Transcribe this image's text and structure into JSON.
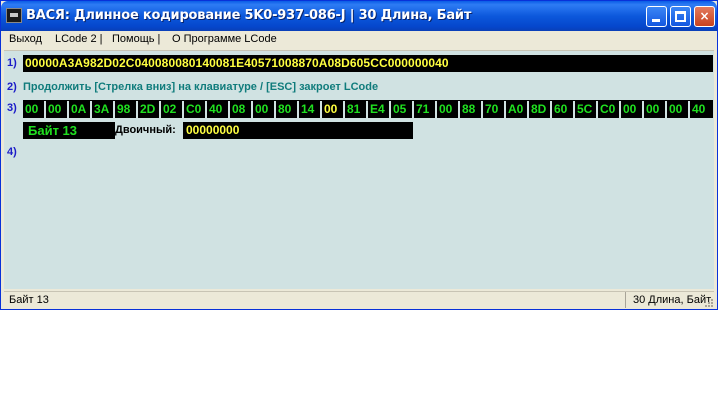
{
  "window": {
    "title": "ВАСЯ: Длинное кодирование  5K0-937-086-J |  30 Длина, Байт",
    "icon": "app-icon",
    "controls": {
      "minimize_icon": "minimize-icon",
      "maximize_icon": "maximize-icon",
      "close_label": "×"
    }
  },
  "menu": [
    {
      "label": "Выход"
    },
    {
      "label": "LCode 2 |"
    },
    {
      "label": "Помощь |"
    },
    {
      "label": "О Программе LCode"
    }
  ],
  "rows": {
    "r1": "1)",
    "r2": "2)",
    "r3": "3)",
    "r4": "4)"
  },
  "hex_string": "00000A3A982D02C040080080140081E40571008870A08D605CC000000040",
  "hint": "Продолжить [Стрелка вниз] на клавиатуре / [ESC] закроет LCode",
  "bytes": [
    "00",
    "00",
    "0A",
    "3A",
    "98",
    "2D",
    "02",
    "C0",
    "40",
    "08",
    "00",
    "80",
    "14",
    "00",
    "81",
    "E4",
    "05",
    "71",
    "00",
    "88",
    "70",
    "A0",
    "8D",
    "60",
    "5C",
    "C0",
    "00",
    "00",
    "00",
    "40"
  ],
  "selected_byte_index": 13,
  "byte_label": "Байт 13",
  "binary_label": "Двоичный:",
  "binary_value": "00000000",
  "status": {
    "left": "Байт 13",
    "right": "30 Длина, Байт"
  },
  "colors": {
    "hex_text": "#ffff40",
    "byte_text": "#20e020",
    "selected_byte_text": "#ffff40",
    "hint_text": "#107c7c",
    "row_number": "#1c1cc8",
    "client_bg": "#d0e2e2"
  }
}
